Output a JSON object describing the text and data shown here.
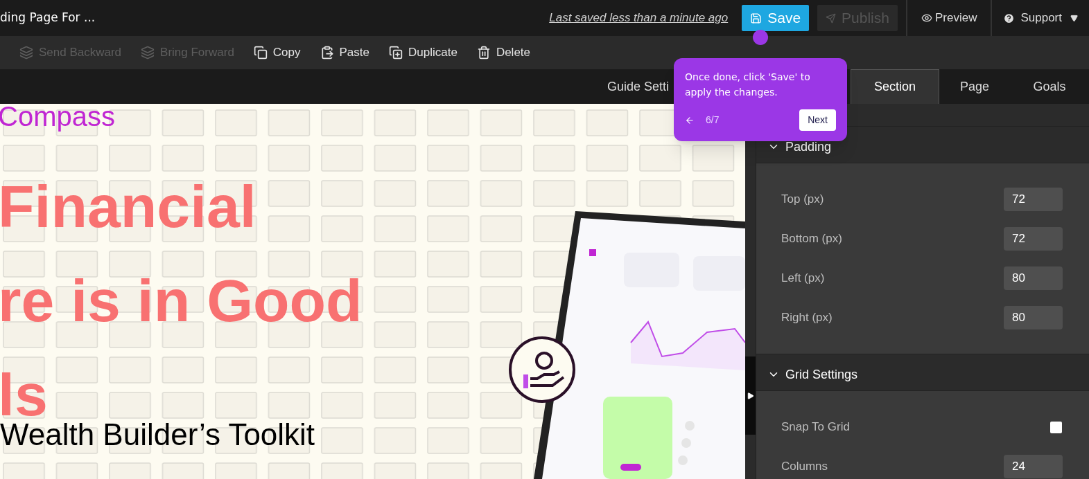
{
  "top_bar": {
    "page_title": "ding Page For ...",
    "save_status": "Last saved  less than a minute ago",
    "save_button": {
      "label": "Save",
      "disabled": false
    },
    "publish_button": {
      "label": "Publish",
      "disabled": true
    },
    "preview": "Preview",
    "support": "Support"
  },
  "toolbar": [
    {
      "label": "Send Backward",
      "kind": "send-backward",
      "disabled": true
    },
    {
      "label": "Bring Forward",
      "kind": "bring-forward",
      "disabled": true
    },
    {
      "label": "Copy",
      "kind": "copy",
      "disabled": false
    },
    {
      "label": "Paste",
      "kind": "paste",
      "disabled": false
    },
    {
      "label": "Duplicate",
      "kind": "duplicate",
      "disabled": false
    },
    {
      "label": "Delete",
      "kind": "delete",
      "disabled": false
    }
  ],
  "tabs": [
    {
      "label": "Guide Setti",
      "selected": false
    },
    {
      "label": "Section",
      "selected": true
    },
    {
      "label": "Page",
      "selected": false
    },
    {
      "label": "Goals",
      "selected": false
    }
  ],
  "canvas": {
    "brand": "Compass",
    "headline": [
      "Financial",
      "re is in Good",
      "ls"
    ],
    "subtitle": "Wealth Builder’s Toolkit",
    "hero_image": {
      "kind": "picture"
    }
  },
  "panel": {
    "sections": [
      {
        "title": "Padding",
        "expanded": true,
        "rows": [
          {
            "kind": "number",
            "label": "Top (px)",
            "value": "72"
          },
          {
            "kind": "number",
            "label": "Bottom (px)",
            "value": "72"
          },
          {
            "kind": "number",
            "label": "Left (px)",
            "value": "80"
          },
          {
            "kind": "number",
            "label": "Right (px)",
            "value": "80"
          }
        ]
      },
      {
        "title": "Grid Settings",
        "expanded": true,
        "rows": [
          {
            "kind": "checkbox",
            "label": "Snap To Grid",
            "checked": false
          },
          {
            "kind": "number",
            "label": "Columns",
            "value": "24"
          }
        ]
      }
    ]
  },
  "guide_tooltip": {
    "text": "Once done, click 'Save' to apply the changes.",
    "step": "6/7",
    "next": "Next"
  }
}
